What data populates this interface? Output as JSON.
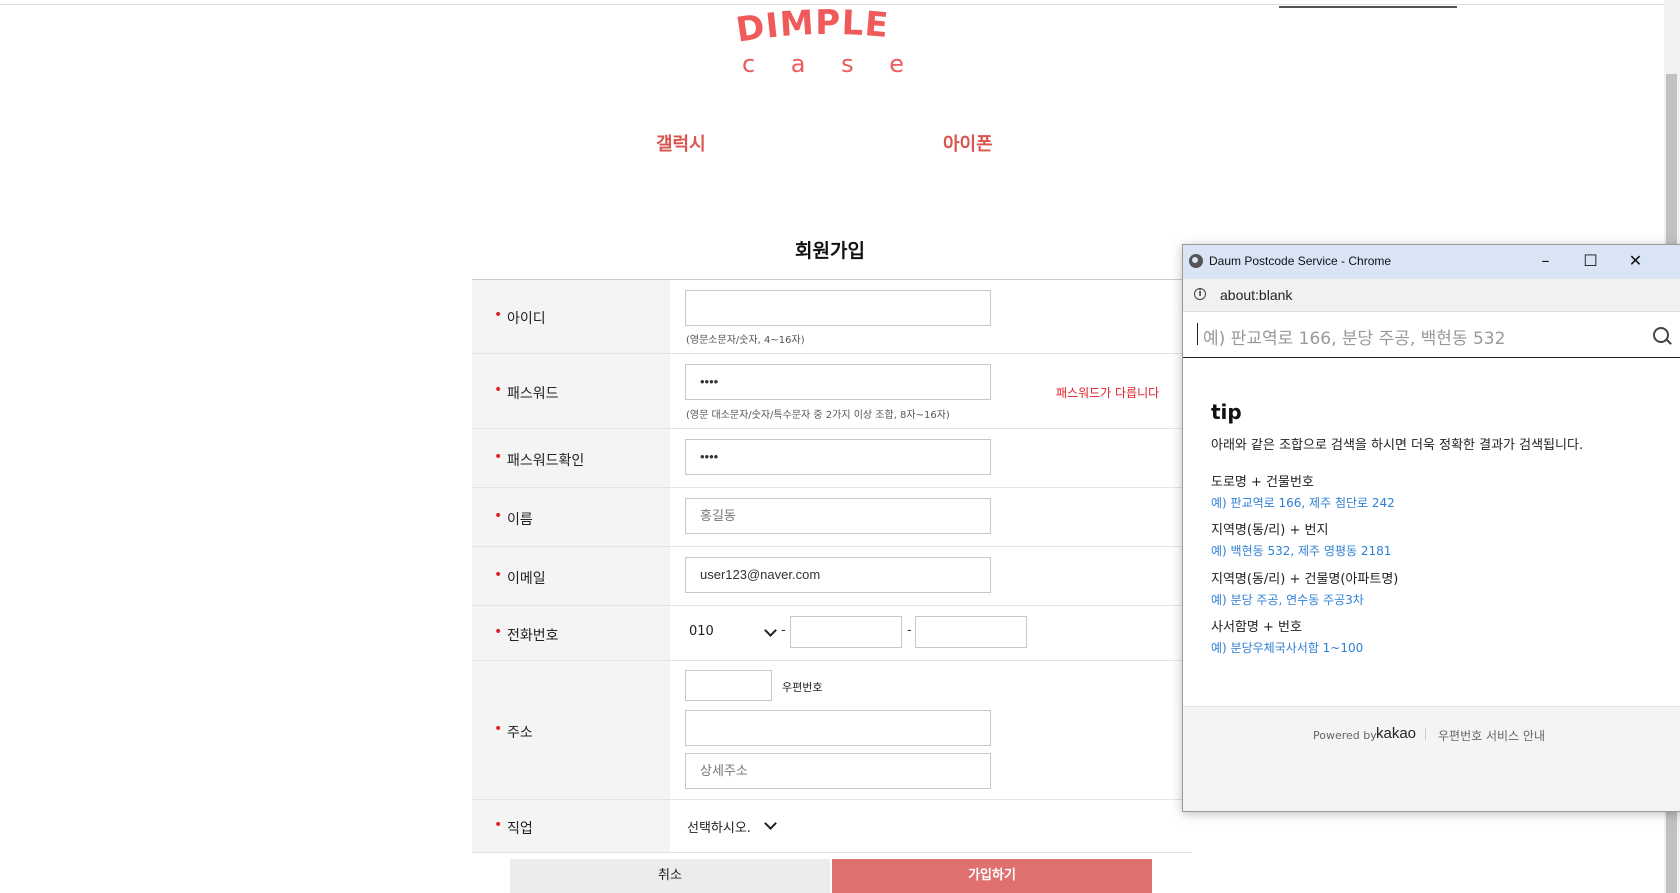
{
  "site": {
    "logo_top": "DIMPLE",
    "logo_bottom": "c a s e",
    "nav": [
      "갤럭시",
      "아이폰"
    ]
  },
  "page": {
    "title": "회원가입"
  },
  "form": {
    "id": {
      "label": "아이디",
      "value": "",
      "hint": "(영문소문자/숫자, 4~16자)"
    },
    "password": {
      "label": "패스워드",
      "value": "••••",
      "hint": "(영문 대소문자/숫자/특수문자 중 2가지 이상 조합, 8자~16자)",
      "error": "패스워드가 다릅니다"
    },
    "password_confirm": {
      "label": "패스워드확인",
      "value": "••••"
    },
    "name": {
      "label": "이름",
      "placeholder": "홍길동"
    },
    "email": {
      "label": "이메일",
      "placeholder": "user123@naver.com"
    },
    "phone": {
      "label": "전화번호",
      "prefix": "010",
      "separator": "-",
      "mid": "",
      "last": ""
    },
    "address": {
      "label": "주소",
      "zipcode_label": "우편번호",
      "line1": "",
      "detail_placeholder": "상세주소"
    },
    "job": {
      "label": "직업",
      "selected": "선택하시오."
    },
    "cancel": "취소",
    "submit": "가입하기"
  },
  "popup": {
    "window_title": "Daum Postcode Service - Chrome",
    "controls": {
      "minimize": "–",
      "maximize": "☐",
      "close": "✕"
    },
    "url": "about:blank",
    "search_placeholder": "예) 판교역로 166, 분당 주공, 백현동 532",
    "tip_title": "tip",
    "tip_desc": "아래와 같은 조합으로 검색을 하시면 더욱 정확한 결과가 검색됩니다.",
    "tips": [
      {
        "heading": "도로명 + 건물번호",
        "example": "예) 판교역로 166,  제주 첨단로 242"
      },
      {
        "heading": "지역명(동/리) + 번지",
        "example": "예) 백현동 532,  제주 영평동 2181"
      },
      {
        "heading": "지역명(동/리) + 건물명(아파트명)",
        "example": "예) 분당 주공,  연수동 주공3차"
      },
      {
        "heading": "사서함명 + 번호",
        "example": "예) 분당우체국사서함 1~100"
      }
    ],
    "powered_by": "Powered by",
    "brand": "kakao",
    "service_guide": "우편번호 서비스 안내"
  },
  "colors": {
    "accent": "#ef5a5a",
    "error": "#e0202b",
    "link": "#2f7fd4",
    "submit_bg": "#e07070"
  }
}
